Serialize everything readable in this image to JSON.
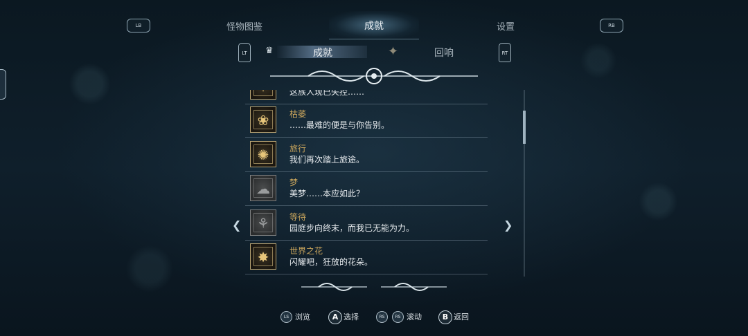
{
  "header": {
    "lb": "LB",
    "rb": "RB",
    "tab_left": "怪物图鉴",
    "tab_active": "成就",
    "tab_right": "设置"
  },
  "subheader": {
    "lt": "LT",
    "rt": "RT",
    "active_label": "成就",
    "inactive_label": "回响"
  },
  "achievements": [
    {
      "title": "",
      "desc": "这族人现已失控……",
      "locked": false,
      "icon": "partial-badge-icon",
      "glyph": "✶"
    },
    {
      "title": "枯萎",
      "desc": "……最难的便是与你告别。",
      "locked": false,
      "icon": "withered-flower-icon",
      "glyph": "❀"
    },
    {
      "title": "旅行",
      "desc": "我们再次踏上旅途。",
      "locked": false,
      "icon": "journey-icon",
      "glyph": "✺"
    },
    {
      "title": "梦",
      "desc": "美梦……本应如此？",
      "locked": true,
      "icon": "dream-icon",
      "glyph": "☁"
    },
    {
      "title": "等待",
      "desc": "园庭步向终末，而我已无能为力。",
      "locked": true,
      "icon": "waiting-icon",
      "glyph": "⚘"
    },
    {
      "title": "世界之花",
      "desc": "闪耀吧，狂放的花朵。",
      "locked": false,
      "icon": "world-flower-icon",
      "glyph": "✸"
    }
  ],
  "footer": {
    "ls": "LS",
    "browse": "浏览",
    "a": "A",
    "select": "选择",
    "rs": "RS",
    "scroll": "滚动",
    "b": "B",
    "back": "返回"
  },
  "colors": {
    "title_gold": "#c9a55c",
    "bg": "#0a1620"
  }
}
